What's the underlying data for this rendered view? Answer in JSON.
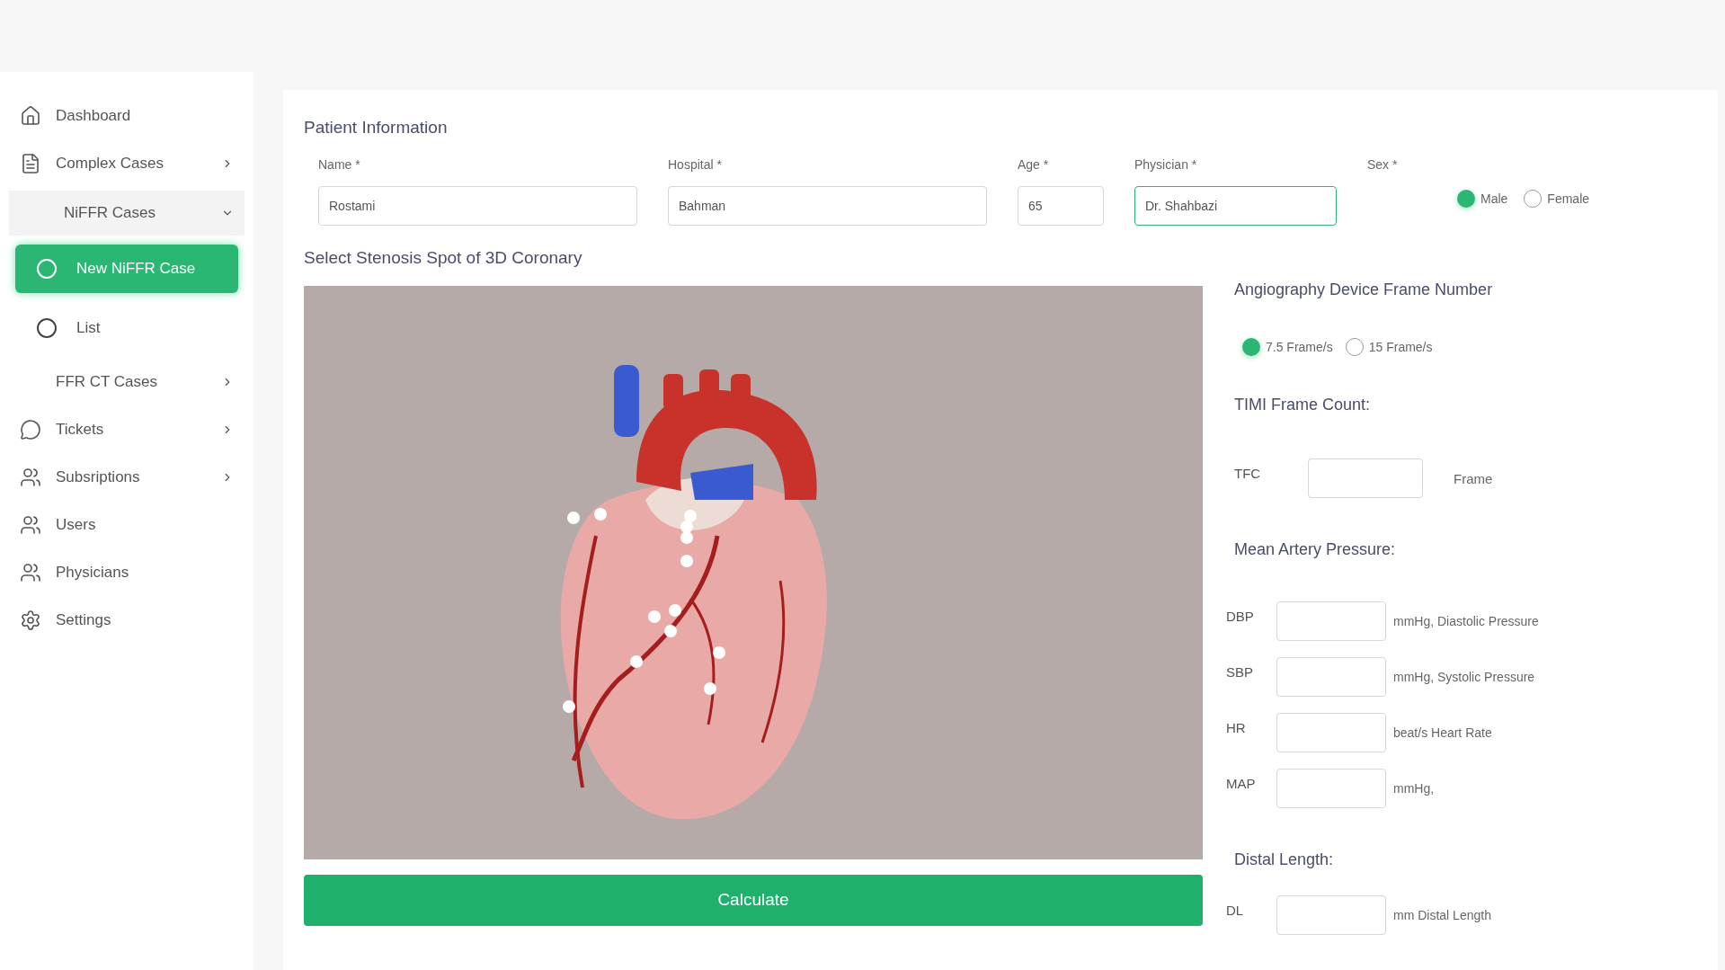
{
  "sidebar": {
    "items": [
      {
        "label": "Dashboard",
        "kind": "link",
        "selected": false
      },
      {
        "label": "Complex Cases",
        "kind": "menu",
        "expanded": false,
        "selected": false
      },
      {
        "label": "NiFFR Cases",
        "kind": "group",
        "expanded": true,
        "selected": false
      },
      {
        "label": "New NiFFR Case",
        "kind": "subitem",
        "selected": true
      },
      {
        "label": "List",
        "kind": "subitem",
        "selected": false
      },
      {
        "label": "FFR CT Cases",
        "kind": "menu",
        "expanded": false,
        "selected": false
      },
      {
        "label": "Tickets",
        "kind": "menu",
        "expanded": false,
        "selected": false
      },
      {
        "label": "Subsriptions",
        "kind": "menu",
        "expanded": false,
        "selected": false
      },
      {
        "label": "Users",
        "kind": "link",
        "selected": false
      },
      {
        "label": "Physicians",
        "kind": "link",
        "selected": false
      },
      {
        "label": "Settings",
        "kind": "link",
        "selected": false
      }
    ]
  },
  "patient": {
    "title": "Patient Information",
    "fields": [
      {
        "label": "Name *",
        "value": "Rostami",
        "focused": false
      },
      {
        "label": "Hospital *",
        "value": "Bahman",
        "focused": false
      },
      {
        "label": "Age *",
        "value": "65",
        "focused": false
      },
      {
        "label": "Physician *",
        "value": "Dr. Shahbazi",
        "focused": true
      }
    ],
    "sex": {
      "label": "Sex *",
      "options": [
        {
          "label": "Male",
          "selected": true
        },
        {
          "label": "Female",
          "selected": false
        }
      ]
    }
  },
  "viewer": {
    "title": "Select Stenosis Spot of 3D Coronary"
  },
  "calculate_button": "Calculate",
  "frame_rate": {
    "title": "Angiography Device Frame Number",
    "options": [
      {
        "label": "7.5 Frame/s",
        "selected": true
      },
      {
        "label": "15 Frame/s",
        "selected": false
      }
    ]
  },
  "sections": [
    {
      "title": "TIMI Frame Count:",
      "rows": [
        {
          "label": "TFC",
          "unit": "Frame"
        }
      ]
    },
    {
      "title": "Mean Artery Pressure:",
      "rows": [
        {
          "label": "DBP",
          "unit": "mmHg, Diastolic Pressure"
        },
        {
          "label": "SBP",
          "unit": "mmHg, Systolic Pressure"
        },
        {
          "label": "HR",
          "unit": "beat/s Heart Rate"
        },
        {
          "label": "MAP",
          "unit": "mmHg,"
        }
      ]
    },
    {
      "title": "Distal Length:",
      "rows": [
        {
          "label": "DL",
          "unit": "mm Distal Length"
        }
      ]
    }
  ]
}
